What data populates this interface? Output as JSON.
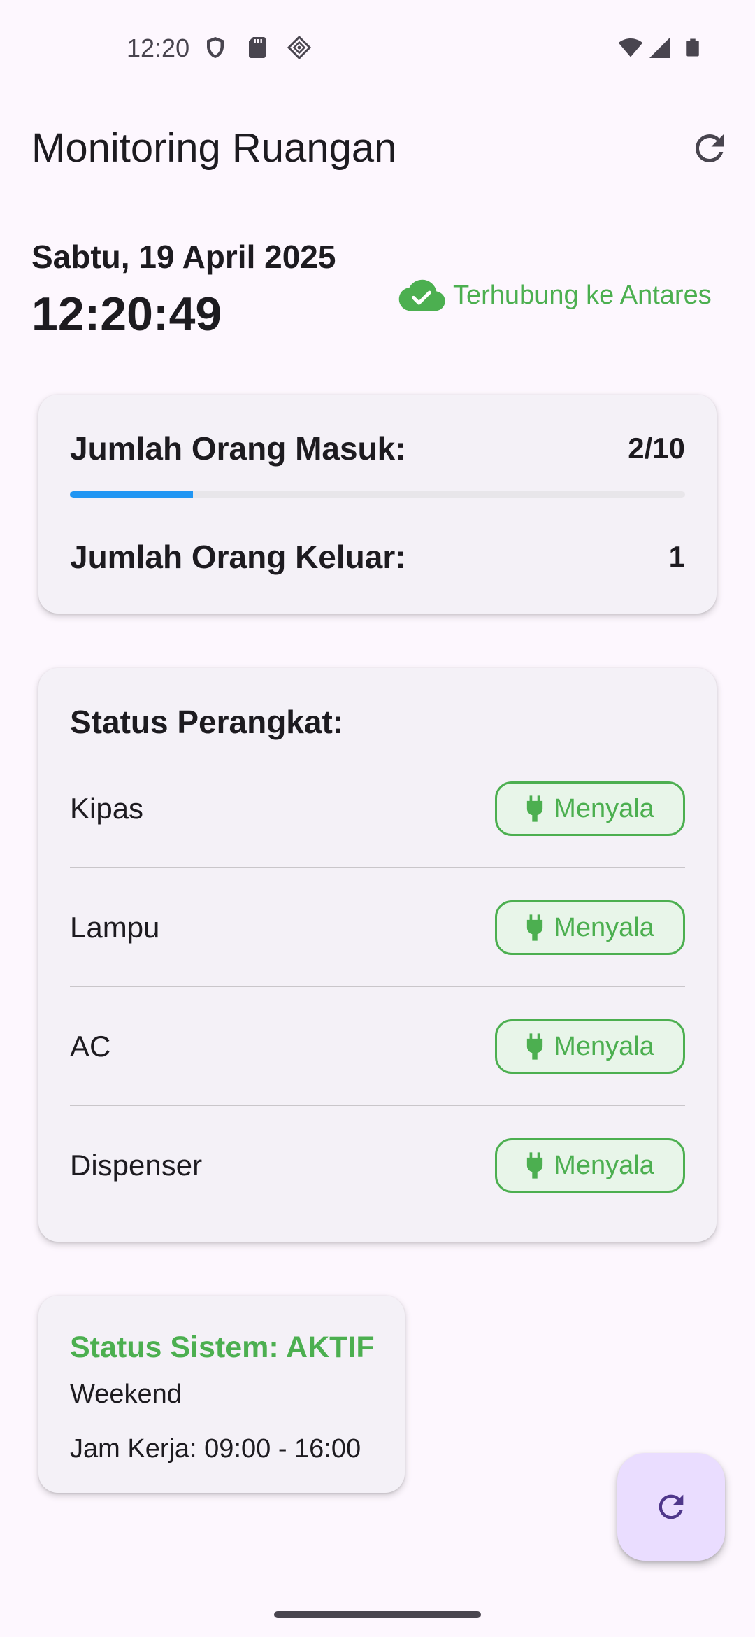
{
  "status_bar": {
    "time": "12:20"
  },
  "app_bar": {
    "title": "Monitoring Ruangan"
  },
  "datetime": {
    "date": "Sabtu, 19 April 2025",
    "time": "12:20:49"
  },
  "connection": {
    "label": "Terhubung ke Antares",
    "color": "#4caf50"
  },
  "people": {
    "in_label": "Jumlah Orang Masuk:",
    "in_value": "2/10",
    "in_progress_fraction": 0.2,
    "out_label": "Jumlah Orang Keluar:",
    "out_value": "1"
  },
  "devices": {
    "title": "Status Perangkat:",
    "items": [
      {
        "name": "Kipas",
        "status": "Menyala"
      },
      {
        "name": "Lampu",
        "status": "Menyala"
      },
      {
        "name": "AC",
        "status": "Menyala"
      },
      {
        "name": "Dispenser",
        "status": "Menyala"
      }
    ]
  },
  "system": {
    "status": "Status Sistem: AKTIF",
    "mode": "Weekend",
    "hours": "Jam Kerja: 09:00 - 16:00"
  },
  "colors": {
    "accent_green": "#4caf50",
    "progress_blue": "#2196f3",
    "fab_bg": "#eaddff",
    "fab_icon": "#4f378b"
  },
  "icons": [
    "shield-icon",
    "sd-card-icon",
    "vpn-icon",
    "wifi-icon",
    "signal-icon",
    "battery-icon",
    "refresh-icon",
    "cloud-done-icon",
    "plug-icon"
  ]
}
